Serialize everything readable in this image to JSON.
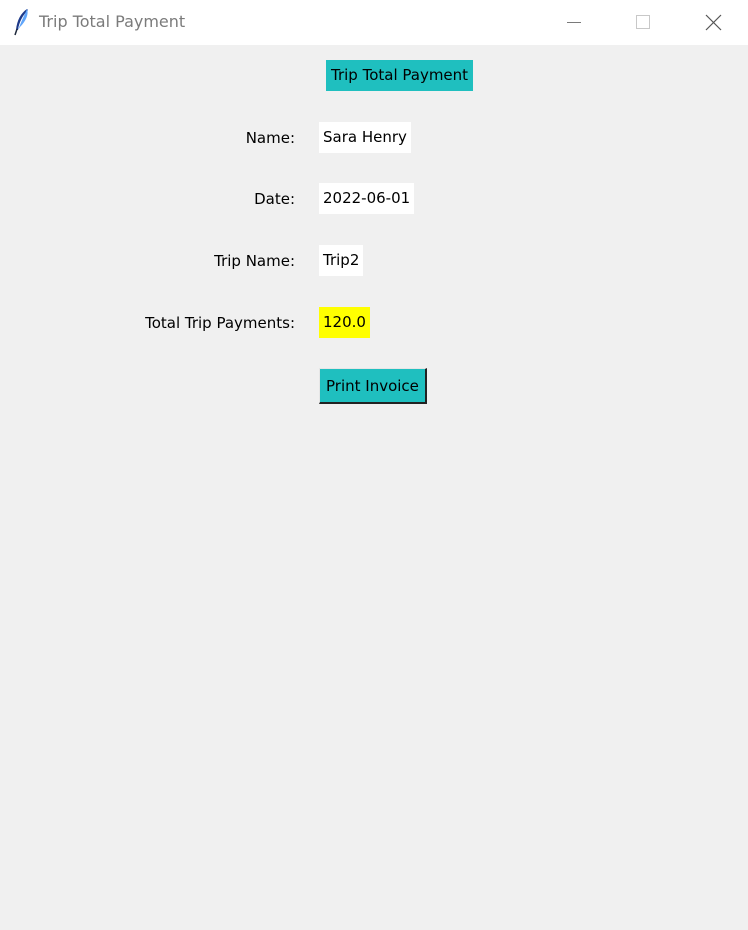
{
  "window": {
    "title": "Trip Total Payment",
    "app_icon": "feather-icon",
    "controls": {
      "minimize_icon": "minimize-icon",
      "maximize_icon": "maximize-icon",
      "close_icon": "close-icon"
    }
  },
  "form": {
    "heading": "Trip Total Payment",
    "fields": [
      {
        "label": "Name:",
        "value": "Sara Henry"
      },
      {
        "label": "Date:",
        "value": "2022-06-01"
      },
      {
        "label": "Trip Name:",
        "value": "Trip2"
      },
      {
        "label": "Total Trip Payments:",
        "value": "120.0"
      }
    ],
    "print_button": "Print Invoice"
  },
  "colors": {
    "accent": "#1fbfbf",
    "highlight": "#ffff00",
    "background": "#f0f0f0"
  }
}
